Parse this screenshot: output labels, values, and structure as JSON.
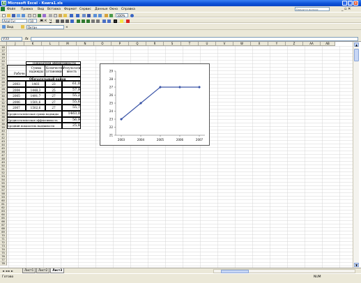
{
  "window": {
    "title": "Microsoft Excel - Книга1.xls",
    "help_placeholder": "Введите вопрос",
    "doc_controls": "_ ▫ ✕"
  },
  "menu": [
    "Файл",
    "Правка",
    "Вид",
    "Вставка",
    "Формат",
    "Сервис",
    "Данные",
    "Окно",
    "Справка"
  ],
  "toolbar": {
    "zoom": "100%",
    "font_name": "Arial Cyr",
    "font_size": "10",
    "font_buttons": [
      "Ж",
      "К",
      "Ч"
    ],
    "explorer_label": "Вид",
    "explorer_field": "Октан"
  },
  "formula": {
    "cell_ref": "V33",
    "fx": "fx",
    "value": ""
  },
  "columns": [
    "J",
    "K",
    "L",
    "M",
    "N",
    "O",
    "P",
    "Q",
    "R",
    "S",
    "T",
    "U",
    "V",
    "W",
    "X",
    "Y",
    "Z",
    "AA",
    "AB"
  ],
  "rows": [
    "16",
    "17",
    "18",
    "19",
    "20",
    "21",
    "22",
    "23",
    "24",
    "25",
    "26",
    "27",
    "28",
    "29",
    "30",
    "31",
    "32",
    "33",
    "34",
    "35",
    "36",
    "37",
    "38",
    "39",
    "40",
    "41",
    "42",
    "43",
    "44",
    "45",
    "46",
    "47",
    "48",
    "49",
    "50",
    "51",
    "52",
    "53",
    "54",
    "55",
    "56",
    "57",
    "58",
    "59",
    "60",
    "61",
    "62",
    "63",
    "64",
    "65",
    "66",
    "67",
    "68",
    "69",
    "70",
    "71",
    "72",
    "73",
    "74",
    "75",
    "76",
    "77",
    "78",
    "79",
    "80"
  ],
  "table": {
    "header": "Показатели эффективности",
    "col_year": "Рабоче",
    "col_sum": "Сумма надежды",
    "col_qty": "Количество установки",
    "col_result": "Результативность",
    "section": "Обязательный район",
    "data": [
      {
        "year": "2003",
        "sum": "1403",
        "qty": "23",
        "res": "61,0"
      },
      {
        "year": "2004",
        "sum": "1448,3",
        "qty": "25",
        "res": "57,9"
      },
      {
        "year": "2005",
        "sum": "1491,7",
        "qty": "27",
        "res": "55,2"
      },
      {
        "year": "2006",
        "sum": "1501,6",
        "qty": "27",
        "res": "55,6"
      },
      {
        "year": "2007",
        "sum": "1502,6",
        "qty": "27",
        "res": "55,7"
      }
    ],
    "summary": [
      {
        "label": "Среднестатическая сумма надежды",
        "value": "1463,0"
      },
      {
        "label": "Среднестатическая эффективность",
        "value": "56,9"
      },
      {
        "label": "Средний показатель надежности",
        "value": "25,8"
      }
    ]
  },
  "chart_data": {
    "type": "line",
    "x": [
      "2003",
      "2004",
      "2005",
      "2006",
      "2007"
    ],
    "series": [
      {
        "values": [
          23,
          25,
          27,
          27,
          27
        ]
      }
    ],
    "ylim": [
      21,
      29
    ],
    "yticks": [
      21,
      22,
      23,
      24,
      25,
      26,
      27,
      28,
      29
    ],
    "color": "#3c56a8",
    "grid": false,
    "legend": "none"
  },
  "sheets": [
    "Лист1",
    "Лист2",
    "Лист3"
  ],
  "active_sheet": "Лист3",
  "tab_nav": "◄ ◄ ► ►",
  "status": {
    "ready": "Готово",
    "num": "NUM"
  }
}
